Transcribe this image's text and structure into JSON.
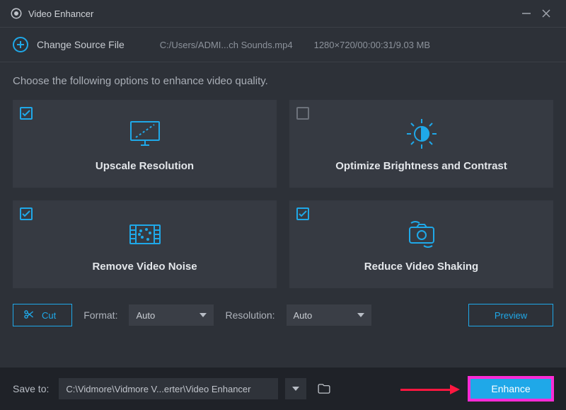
{
  "titlebar": {
    "title": "Video Enhancer"
  },
  "source": {
    "change_label": "Change Source File",
    "path": "C:/Users/ADMI...ch Sounds.mp4",
    "meta": "1280×720/00:00:31/9.03 MB"
  },
  "instruction": "Choose the following options to enhance video quality.",
  "options": {
    "upscale": {
      "label": "Upscale Resolution",
      "checked": true
    },
    "brightness": {
      "label": "Optimize Brightness and Contrast",
      "checked": false
    },
    "noise": {
      "label": "Remove Video Noise",
      "checked": true
    },
    "shaking": {
      "label": "Reduce Video Shaking",
      "checked": true
    }
  },
  "controls": {
    "cut_label": "Cut",
    "format_label": "Format:",
    "format_value": "Auto",
    "resolution_label": "Resolution:",
    "resolution_value": "Auto",
    "preview_label": "Preview"
  },
  "bottom": {
    "saveto_label": "Save to:",
    "path": "C:\\Vidmore\\Vidmore V...erter\\Video Enhancer",
    "enhance_label": "Enhance"
  },
  "colors": {
    "accent": "#1fa8e8",
    "annotation": "#ff1740",
    "highlight_border": "#ff2bd6"
  }
}
